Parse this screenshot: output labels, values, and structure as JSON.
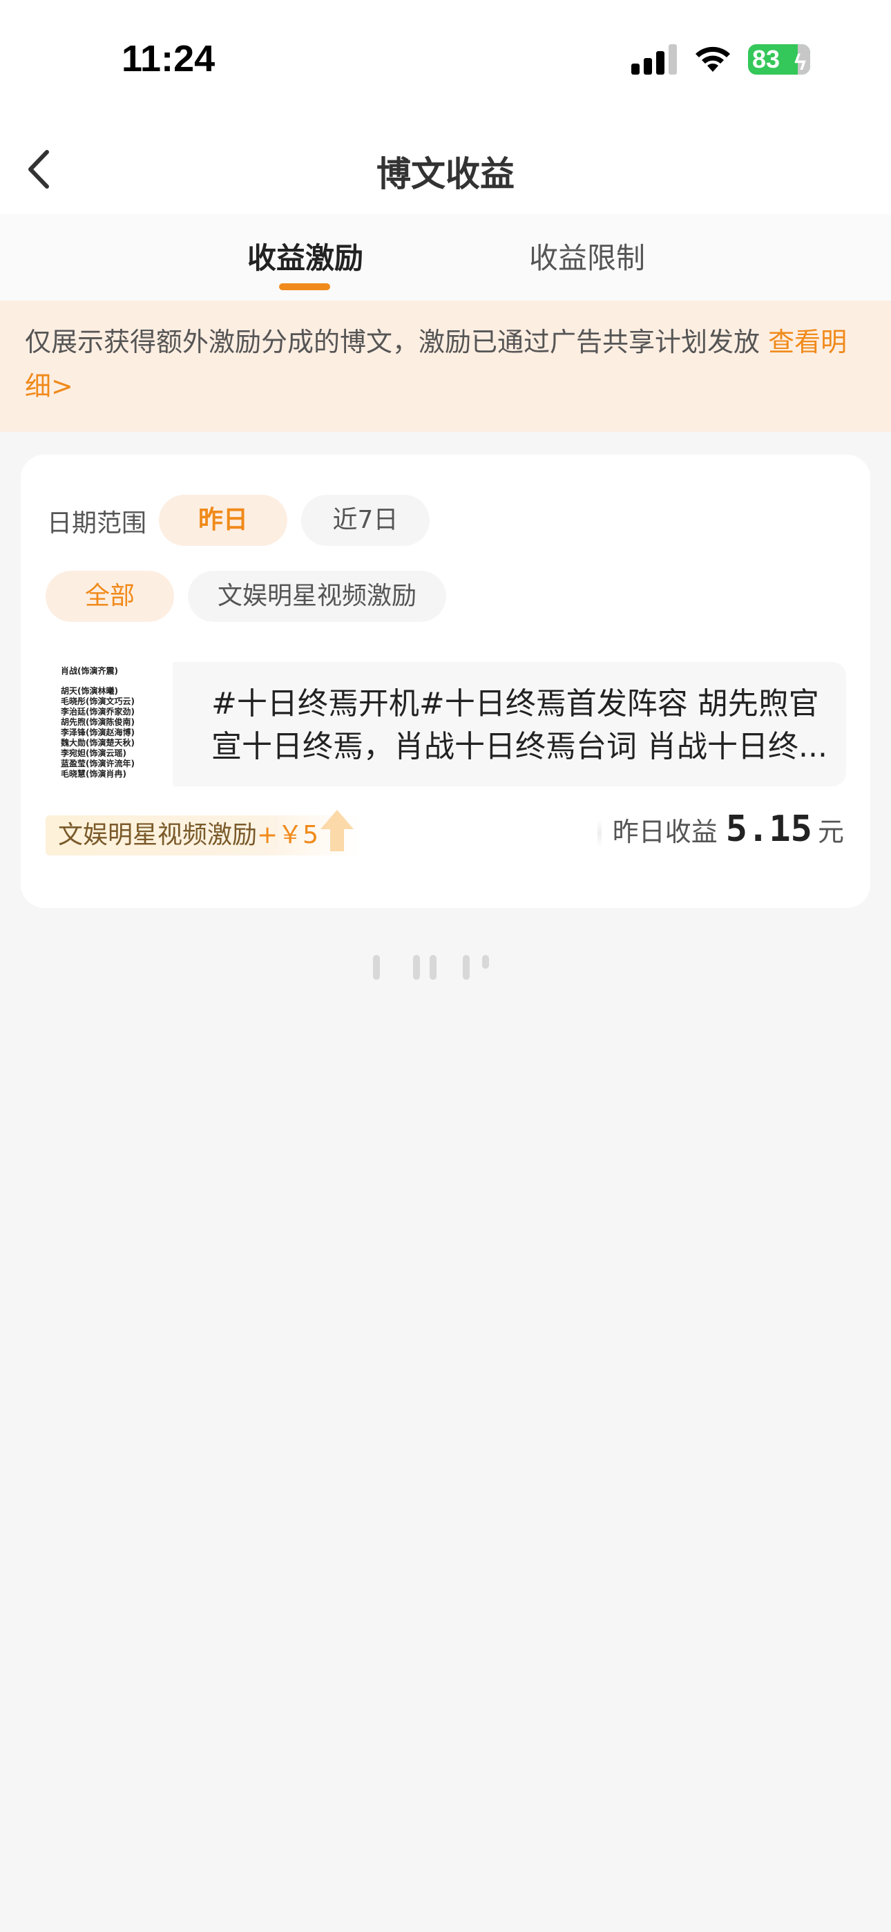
{
  "status_bar": {
    "time": "11:24",
    "battery": "83",
    "signal_icon": "cellular-signal-icon",
    "wifi_icon": "wifi-icon",
    "battery_color": "#34c759"
  },
  "nav": {
    "back_icon": "chevron-left-icon",
    "title": "博文收益"
  },
  "tabs": [
    {
      "label": "收益激励",
      "active": true
    },
    {
      "label": "收益限制",
      "active": false
    }
  ],
  "notice": {
    "text": "仅展示获得额外激励分成的博文，激励已通过广告共享计划发放 ",
    "link": "查看明细>"
  },
  "filters": {
    "date_label": "日期范围",
    "date_options": [
      {
        "label": "昨日",
        "active": true
      },
      {
        "label": "近7日",
        "active": false
      }
    ],
    "type_options": [
      {
        "label": "全部",
        "active": true
      },
      {
        "label": "文娱明星视频激励",
        "active": false
      }
    ]
  },
  "post": {
    "thumbnail_lines": [
      "肖战(饰演齐震)",
      "胡天(饰演林曦)",
      "毛晓彤(饰演文巧云)",
      "李治廷(饰演乔家劲)",
      "胡先煦(饰演陈俊南)",
      "李泽锋(饰演赵海博)",
      "魏大勋(饰演楚天秋)",
      "李宛妲(饰演云瑶)",
      "蓝盈莹(饰演许流年)",
      "毛晓慧(饰演肖冉)"
    ],
    "text": "#十日终焉开机#十日终焉首发阵容 胡先煦官宣十日终焉，肖战十日终焉台词 肖战十日终..."
  },
  "reward": {
    "label": "文娱明星视频激励",
    "amount": "+￥5",
    "arrow_icon": "up-arrow-icon"
  },
  "earning": {
    "label": "昨日收益",
    "value": "5.15",
    "unit": "元"
  },
  "colors": {
    "accent": "#f08a1a",
    "notice_bg": "#fdeee2"
  }
}
